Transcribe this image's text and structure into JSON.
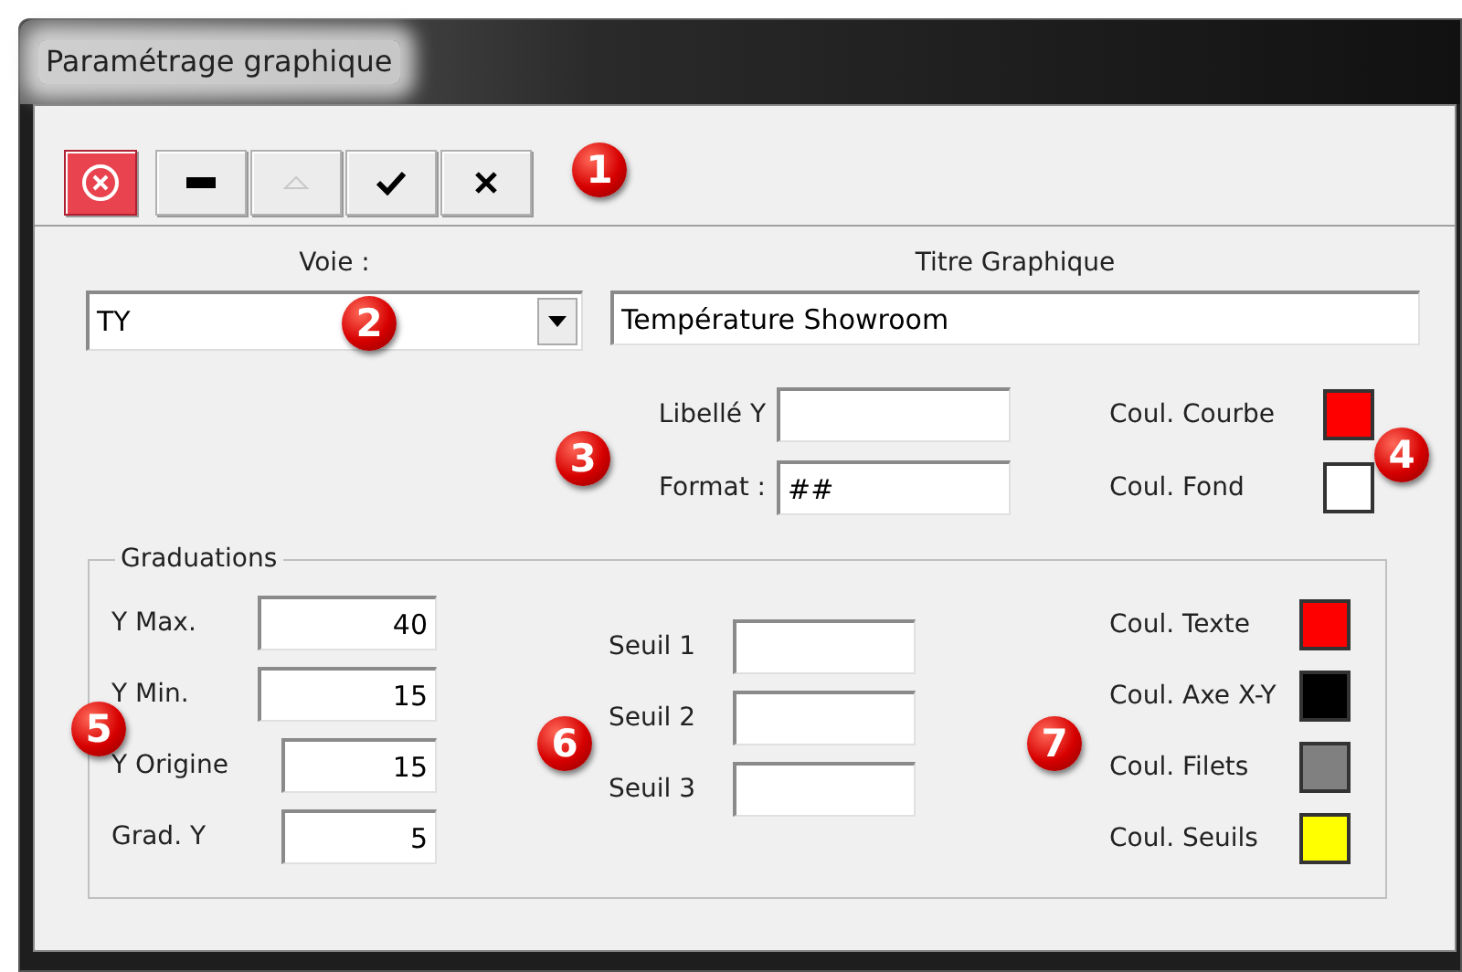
{
  "window": {
    "title": "Paramétrage graphique"
  },
  "toolbar": [
    {
      "kind": "close",
      "disabled": false
    },
    {
      "kind": "minus",
      "disabled": false
    },
    {
      "kind": "up",
      "disabled": true
    },
    {
      "kind": "check",
      "disabled": false
    },
    {
      "kind": "cross",
      "disabled": false
    }
  ],
  "callouts": [
    "1",
    "2",
    "3",
    "4",
    "5",
    "6",
    "7"
  ],
  "voie": {
    "label": "Voie :",
    "value": "TY"
  },
  "titre": {
    "label": "Titre Graphique",
    "value": "Température Showroom"
  },
  "libelle_y": {
    "label": "Libellé Y"
  },
  "format": {
    "label": "Format :",
    "value": "##"
  },
  "curve_colors": [
    {
      "label": "Coul. Courbe",
      "color": "#ff0000"
    },
    {
      "label": "Coul. Fond",
      "color": "#ffffff"
    }
  ],
  "graduations": {
    "title": "Graduations",
    "scale": [
      {
        "label": "Y Max.",
        "value": "40"
      },
      {
        "label": "Y Min.",
        "value": "15"
      },
      {
        "label": "Y Origine",
        "value": "15"
      },
      {
        "label": "Grad. Y",
        "value": "5"
      }
    ],
    "thresholds": [
      {
        "label": "Seuil 1"
      },
      {
        "label": "Seuil 2"
      },
      {
        "label": "Seuil 3"
      }
    ],
    "colors": [
      {
        "label": "Coul. Texte",
        "color": "#ff0000"
      },
      {
        "label": "Coul. Axe X-Y",
        "color": "#000000"
      },
      {
        "label": "Coul. Filets",
        "color": "#808080"
      },
      {
        "label": "Coul. Seuils",
        "color": "#ffff00"
      }
    ]
  }
}
